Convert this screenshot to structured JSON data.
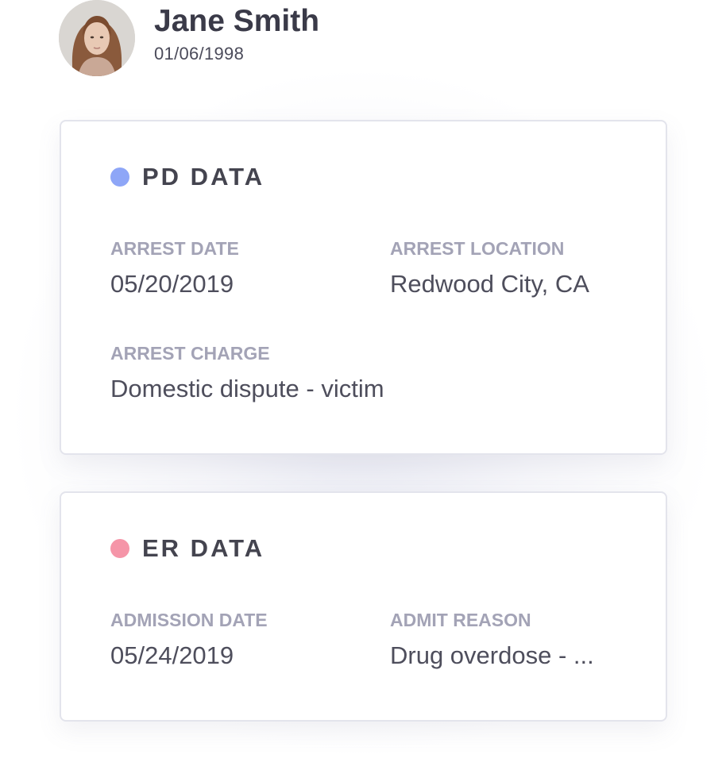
{
  "profile": {
    "name": "Jane Smith",
    "dob": "01/06/1998",
    "avatar_icon": "person-photo"
  },
  "colors": {
    "pd_dot": "#8ea6f7",
    "er_dot": "#f595a8",
    "label": "#a3a3b6",
    "value": "#4e4e5c",
    "title": "#44444f"
  },
  "pd": {
    "title": "PD DATA",
    "fields": [
      {
        "label": "ARREST DATE",
        "value": "05/20/2019"
      },
      {
        "label": "ARREST LOCATION",
        "value": "Redwood City, CA"
      },
      {
        "label": "ARREST CHARGE",
        "value": "Domestic dispute - victim"
      }
    ]
  },
  "er": {
    "title": "ER DATA",
    "fields": [
      {
        "label": "ADMISSION DATE",
        "value": "05/24/2019"
      },
      {
        "label": "ADMIT REASON",
        "value": "Drug overdose - ..."
      }
    ]
  }
}
